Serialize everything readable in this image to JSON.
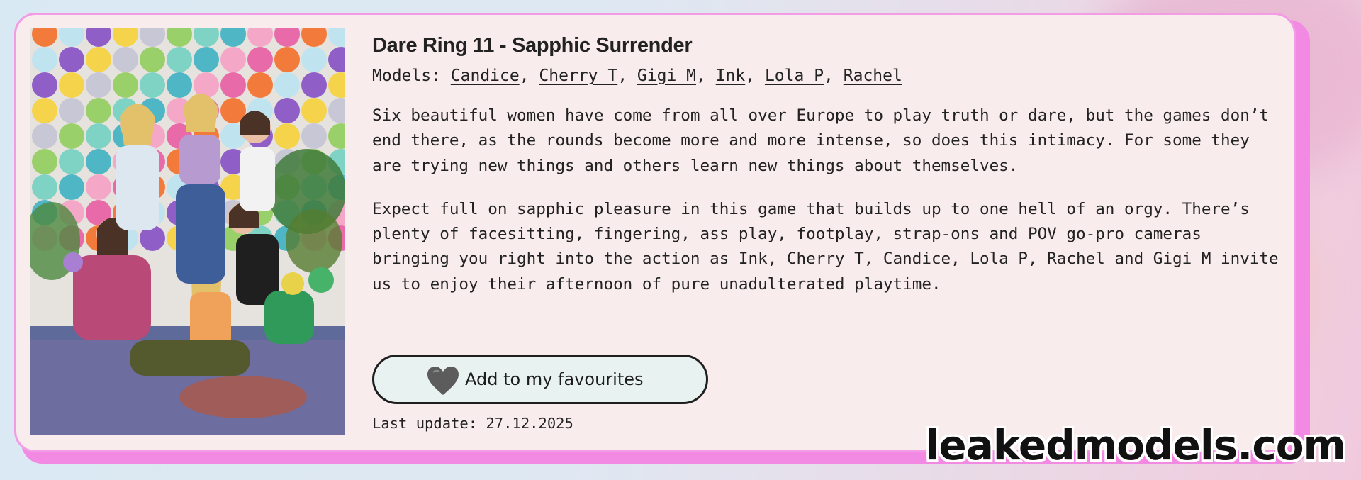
{
  "card": {
    "title": "Dare Ring 11 - Sapphic Surrender",
    "models_label": "Models: ",
    "models": [
      "Candice",
      "Cherry T",
      "Gigi M",
      "Ink",
      "Lola P",
      "Rachel"
    ],
    "description": [
      "Six beautiful women have come from all over Europe to play truth or dare, but the games don’t end there, as the rounds become more and more intense, so does this intimacy. For some they are trying new things and others learn new things about themselves.",
      "Expect full on sapphic pleasure in this game that builds up to one hell of an orgy. There’s plenty of facesitting, fingering, ass play, footplay, strap-ons and POV go-pro cameras bringing you right into the action as Ink, Cherry T, Candice, Lola P, Rachel and Gigi M invite us to enjoy their afternoon of pure unadulterated playtime."
    ],
    "favourite_button": "Add to my favourites",
    "favourite_icon": "heart-icon",
    "last_update": "Last update: 27.12.2025"
  },
  "watermark": "leakedmodels.com",
  "colors": {
    "card_background": "#f9ecec",
    "card_border": "#f39be5",
    "accent_pink": "#f28ae4",
    "button_background": "#e8f3f1"
  }
}
